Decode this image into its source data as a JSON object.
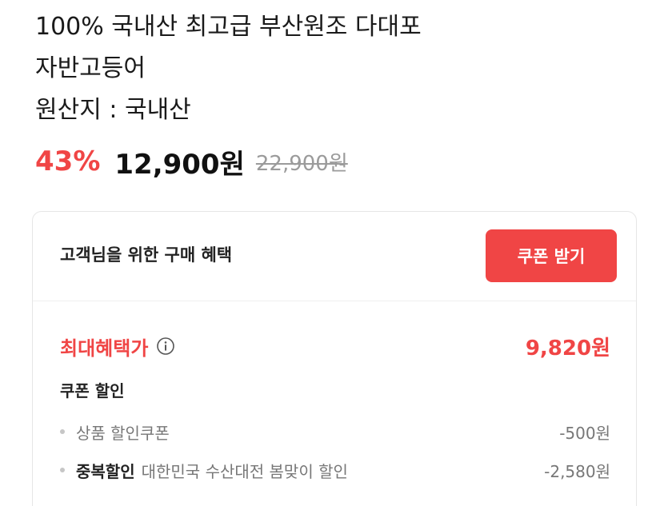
{
  "product": {
    "title_line1": "100% 국내산 최고급 부산원조 다대포",
    "title_line2": "자반고등어",
    "origin": "원산지 : 국내산",
    "discount_rate": "43%",
    "sale_price": "12,900원",
    "original_price": "22,900원"
  },
  "benefits": {
    "header_title": "고객님을 위한 구매 혜택",
    "coupon_button_label": "쿠폰 받기",
    "max_benefit_label": "최대혜택가",
    "max_benefit_price": "9,820원",
    "coupon_section_title": "쿠폰 할인",
    "items": [
      {
        "bold_label": "",
        "label": "상품 할인쿠폰",
        "amount": "-500원"
      },
      {
        "bold_label": "중복할인",
        "label": "대한민국 수산대전 봄맞이 할인",
        "amount": "-2,580원"
      }
    ]
  },
  "colors": {
    "accent_red": "#f04545",
    "text_dark": "#111111",
    "text_gray": "#777777"
  },
  "icons": {
    "info": "info-circle-icon"
  }
}
